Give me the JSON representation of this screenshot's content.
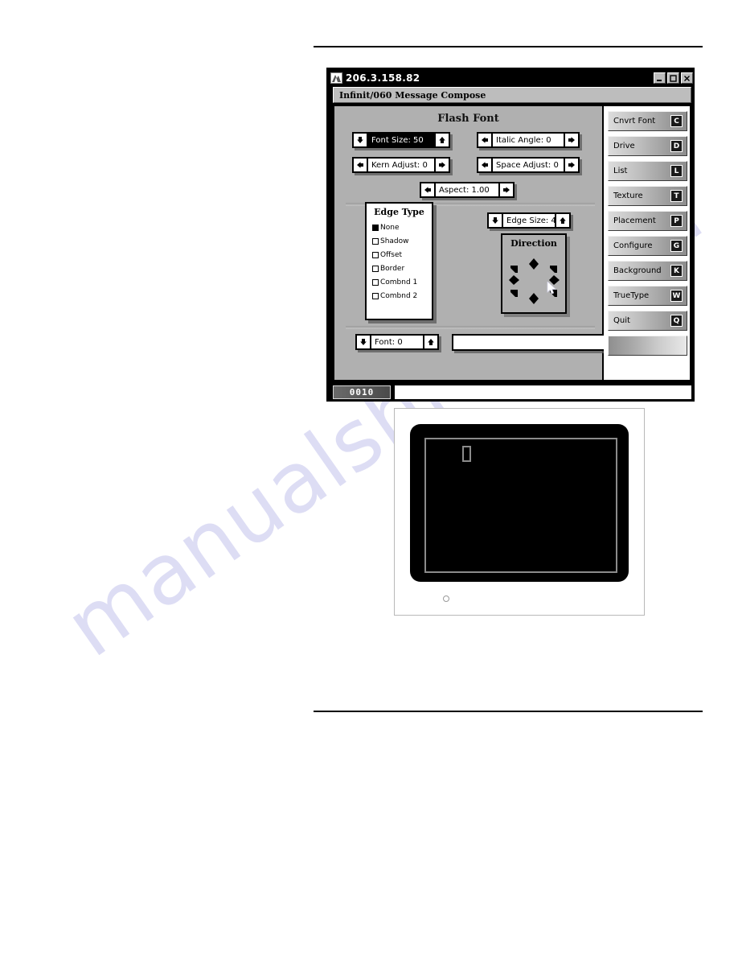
{
  "page": {
    "watermark": "manualshive.com"
  },
  "window": {
    "title": "206.3.158.82",
    "icon": "mountain-icon",
    "controls": [
      {
        "name": "minimize",
        "glyph": "minimize-icon"
      },
      {
        "name": "maximize",
        "glyph": "maximize-icon"
      },
      {
        "name": "close",
        "glyph": "close-icon"
      }
    ]
  },
  "header": {
    "label": "Infinit/060   Message Compose"
  },
  "main": {
    "panel_title": "Flash Font",
    "spinners": [
      {
        "id": "font-size",
        "label": "Font Size: 50",
        "inverted": true,
        "left_arrow": "down-arrow-icon",
        "right_arrow": "up-arrow-icon"
      },
      {
        "id": "italic-angle",
        "label": "Italic Angle: 0",
        "inverted": false,
        "left_arrow": "left-arrow-icon",
        "right_arrow": "right-arrow-icon"
      },
      {
        "id": "kern-adjust",
        "label": "Kern Adjust: 0",
        "inverted": false,
        "left_arrow": "left-arrow-icon",
        "right_arrow": "right-arrow-icon"
      },
      {
        "id": "space-adjust",
        "label": "Space Adjust: 0",
        "inverted": false,
        "left_arrow": "left-arrow-icon",
        "right_arrow": "right-arrow-icon"
      },
      {
        "id": "aspect",
        "label": "Aspect: 1.00",
        "inverted": false,
        "left_arrow": "left-arrow-icon",
        "right_arrow": "right-arrow-icon"
      },
      {
        "id": "edge-size",
        "label": "Edge Size: 4",
        "inverted": false,
        "left_arrow": "down-arrow-icon",
        "right_arrow": "up-arrow-icon"
      },
      {
        "id": "font",
        "label": "Font: 0",
        "inverted": false,
        "left_arrow": "down-arrow-icon",
        "right_arrow": "up-arrow-icon"
      }
    ],
    "edge_type": {
      "title": "Edge Type",
      "items": [
        {
          "label": "None",
          "selected": true
        },
        {
          "label": "Shadow",
          "selected": false
        },
        {
          "label": "Offset",
          "selected": false
        },
        {
          "label": "Border",
          "selected": false
        },
        {
          "label": "Combnd 1",
          "selected": false
        },
        {
          "label": "Combnd 2",
          "selected": false
        }
      ]
    },
    "direction": {
      "title": "Direction",
      "points": [
        "n",
        "ne",
        "e",
        "se",
        "s",
        "sw",
        "w",
        "nw"
      ],
      "cursor": "mouse-pointer-icon"
    },
    "text_field_value": ""
  },
  "sidebar": {
    "buttons": [
      {
        "label": "Cnvrt Font",
        "key": "C"
      },
      {
        "label": "Drive",
        "key": "D"
      },
      {
        "label": "List",
        "key": "L"
      },
      {
        "label": "Texture",
        "key": "T"
      },
      {
        "label": "Placement",
        "key": "P"
      },
      {
        "label": "Configure",
        "key": "G"
      },
      {
        "label": "Background",
        "key": "K"
      },
      {
        "label": "TrueType",
        "key": "W"
      },
      {
        "label": "Quit",
        "key": "Q"
      }
    ],
    "gradient_swatch": "gradient-swatch"
  },
  "status": {
    "code": "0010",
    "message": ""
  },
  "figure": {
    "name": "led-sign-display",
    "screen_cursor": "block-cursor",
    "power_led": "power-led-indicator"
  },
  "colors": {
    "window_chrome": "#000000",
    "panel_face": "#b0b0b0",
    "button_face": "#c2c2c2",
    "key_badge": "#1a1a1a",
    "watermark": "#c9c9ee",
    "screen": "#000000",
    "screen_border": "#8b8b8b"
  }
}
